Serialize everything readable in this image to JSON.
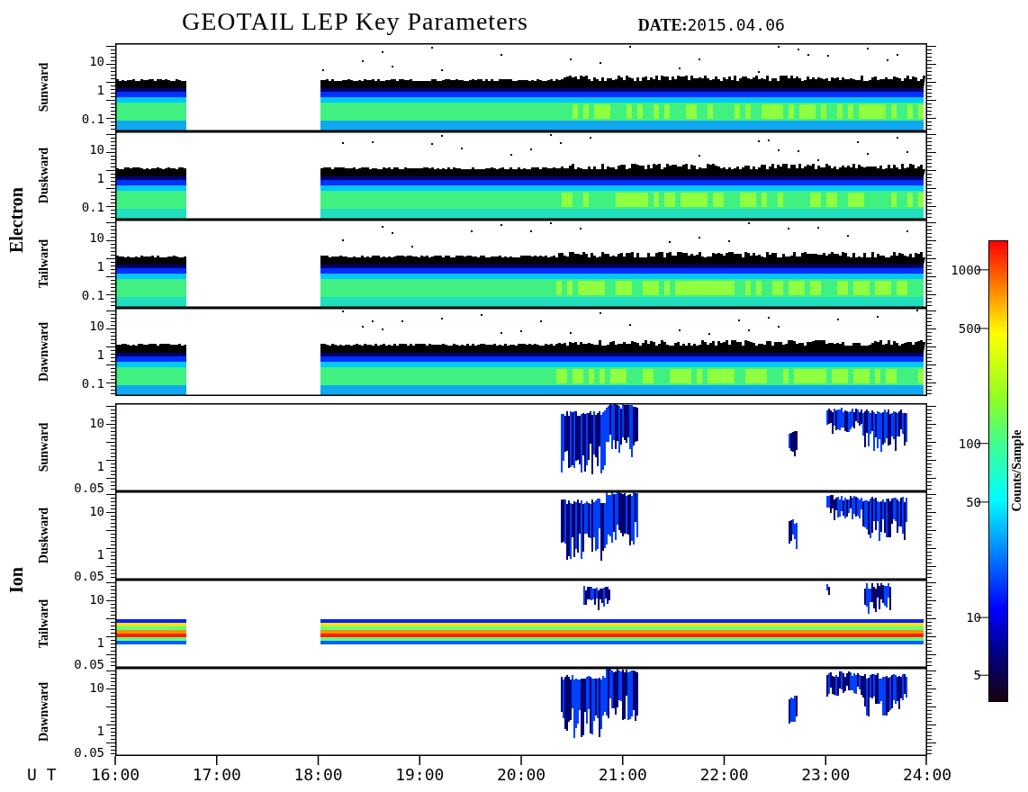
{
  "title": "GEOTAIL LEP Key Parameters",
  "date_label": "DATE:",
  "date": "2015.04.06",
  "groups": [
    {
      "label": "Electron",
      "kind": "electron",
      "panels": [
        {
          "label": "Sunward",
          "y_ticks": [
            "10",
            "1",
            "0.1"
          ]
        },
        {
          "label": "Duskward",
          "y_ticks": [
            "10",
            "1",
            "0.1"
          ]
        },
        {
          "label": "Tailward",
          "y_ticks": [
            "10",
            "1",
            "0.1"
          ]
        },
        {
          "label": "Dawnward",
          "y_ticks": [
            "10",
            "1",
            "0.1"
          ]
        }
      ]
    },
    {
      "label": "Ion",
      "kind": "ion",
      "panels": [
        {
          "label": "Sunward",
          "y_ticks": [
            "10",
            "1",
            "0.05"
          ]
        },
        {
          "label": "Duskward",
          "y_ticks": [
            "10",
            "1",
            "0.05"
          ]
        },
        {
          "label": "Tailward",
          "y_ticks": [
            "10",
            "1",
            "0.05"
          ]
        },
        {
          "label": "Dawnward",
          "y_ticks": [
            "10",
            "1",
            "0.05"
          ]
        }
      ]
    }
  ],
  "time_axis": {
    "label": "U T",
    "ticks": [
      "16:00",
      "17:00",
      "18:00",
      "19:00",
      "20:00",
      "21:00",
      "22:00",
      "23:00",
      "24:00"
    ]
  },
  "colorbar": {
    "label": "Counts/Sample",
    "ticks": [
      "1000",
      "500",
      "100",
      "50",
      "10",
      "5"
    ]
  }
}
